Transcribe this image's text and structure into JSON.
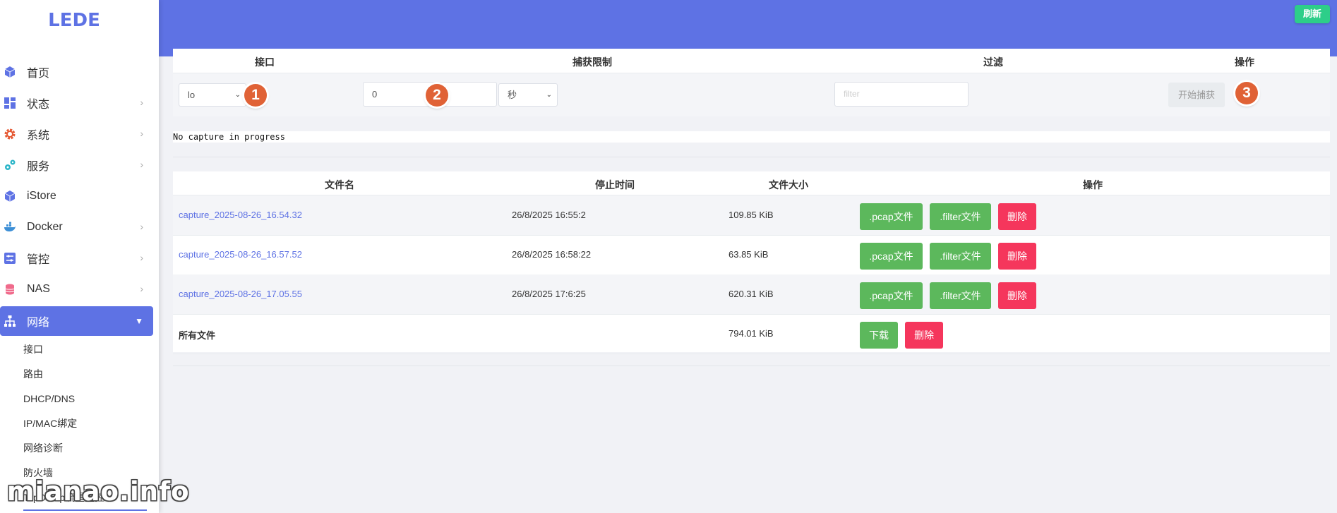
{
  "sidebar": {
    "logo": "LEDE",
    "items": [
      {
        "label": "首页",
        "icon": "cube-icon",
        "chevron": false
      },
      {
        "label": "状态",
        "icon": "dashboard-icon",
        "chevron": true
      },
      {
        "label": "系统",
        "icon": "gear-icon",
        "chevron": true
      },
      {
        "label": "服务",
        "icon": "services-icon",
        "chevron": true
      },
      {
        "label": "iStore",
        "icon": "cube-icon",
        "chevron": false
      },
      {
        "label": "Docker",
        "icon": "docker-icon",
        "chevron": true
      },
      {
        "label": "管控",
        "icon": "sliders-icon",
        "chevron": true
      },
      {
        "label": "NAS",
        "icon": "database-icon",
        "chevron": true
      },
      {
        "label": "网络",
        "icon": "network-icon",
        "chevron": true,
        "active": true
      }
    ],
    "subitems": [
      "接口",
      "路由",
      "DHCP/DNS",
      "IP/MAC绑定",
      "网络诊断",
      "防火墙",
      "TcpDump流量监控"
    ]
  },
  "header": {
    "refresh_label": "刷新"
  },
  "capture": {
    "headers": {
      "interface": "接口",
      "limit": "捕获限制",
      "filter": "过滤",
      "action": "操作"
    },
    "interface_value": "lo",
    "limit_value": "0",
    "unit_value": "秒",
    "filter_placeholder": "filter",
    "start_label": "开始捕获",
    "badges": [
      "1",
      "2",
      "3"
    ]
  },
  "status": {
    "text": "No capture in progress"
  },
  "files": {
    "headers": {
      "name": "文件名",
      "stop_time": "停止时间",
      "size": "文件大小",
      "action": "操作"
    },
    "rows": [
      {
        "name": "capture_2025-08-26_16.54.32",
        "stop_time": "26/8/2025 16:55:2",
        "size": "109.85 KiB"
      },
      {
        "name": "capture_2025-08-26_16.57.52",
        "stop_time": "26/8/2025 16:58:22",
        "size": "63.85 KiB"
      },
      {
        "name": "capture_2025-08-26_17.05.55",
        "stop_time": "26/8/2025 17:6:25",
        "size": "620.31 KiB"
      }
    ],
    "pcap_label": ".pcap文件",
    "filter_label": ".filter文件",
    "delete_label": "删除",
    "all_label": "所有文件",
    "all_size": "794.01 KiB",
    "download_label": "下载"
  },
  "watermark": "mianao.info",
  "colors": {
    "accent": "#5e72e4",
    "success": "#2dce89",
    "green_button": "#5cb85c",
    "danger": "#f5365c",
    "badge": "#e06236"
  }
}
